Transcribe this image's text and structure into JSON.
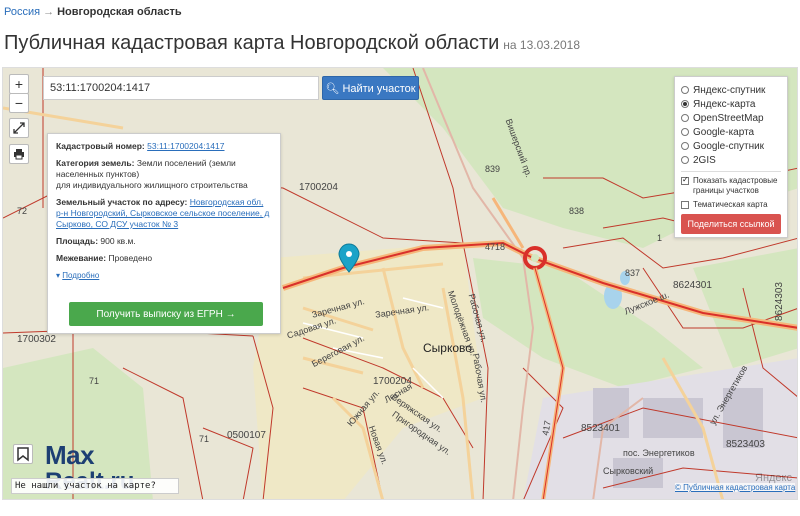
{
  "breadcrumb": {
    "root": "Россия",
    "separator": "→",
    "current": "Новгородская область"
  },
  "page": {
    "title": "Публичная кадастровая карта Новгородской области",
    "date": "на 13.03.2018"
  },
  "map": {
    "zoom_in": "+",
    "zoom_out": "−",
    "search_value": "53:11:1700204:1417",
    "search_button": "Найти участок",
    "labels": {
      "block_1700204_top": "1700204",
      "block_1700204_bottom": "1700204",
      "block_1700302": "1700302",
      "block_0500107": "0500107",
      "block_8624301": "8624301",
      "block_8624303": "8624303",
      "block_8523401": "8523401",
      "block_8523403": "8523403",
      "village": "Сырково",
      "settlement": "пос. Энергетиков",
      "road_syrkovsky": "Сырковский",
      "street_zarechnaya_1": "Заречная ул.",
      "street_zarechnaya_2": "Заречная ул.",
      "street_sadovaya": "Садовая ул.",
      "street_beregovaya": "Береговая ул.",
      "street_molodezhnaya": "Молодёжная ул.",
      "street_rabochaya_1": "Рабочая ул.",
      "street_rabochaya_2": "Рабочая ул.",
      "street_yuzhnaya": "Южная ул.",
      "street_lesnaya": "Лесная",
      "street_verzhskaya": "Веряжская ул.",
      "street_prigorodnaya": "Пригородная ул.",
      "street_novaya": "Новая ул.",
      "street_lyuzhskoe": "Лужское ш.",
      "street_energetikov": "ул. Энергетиков",
      "street_vishersky": "Вишерский пр.",
      "num_839": "839",
      "num_838": "838",
      "num_837": "837",
      "num_4718": "4718",
      "num_72": "72",
      "num_71a": "71",
      "num_71b": "71",
      "num_1": "1",
      "num_417": "417"
    }
  },
  "info_card": {
    "cadastral_label": "Кадастровый номер:",
    "cadastral_value": "53:11:1700204:1417",
    "category_label": "Категория земель:",
    "category_value": "Земли поселений (земли населенных пунктов)",
    "category_purpose": "для индивидуального жилищного строительства",
    "address_label": "Земельный участок по адресу:",
    "address_value": "Новгородская обл, р-н Новгородский, Сырковское сельское поселение, д Сырково, СО ДСУ участок № 3",
    "area_label": "Площадь:",
    "area_value": "900 кв.м.",
    "survey_label": "Межевание:",
    "survey_value": "Проведено",
    "more_link": "Подробно",
    "egrn_button": "Получить выписку из ЕГРН →"
  },
  "layers": {
    "options": [
      {
        "label": "Яндекс-спутник",
        "selected": false
      },
      {
        "label": "Яндекс-карта",
        "selected": true
      },
      {
        "label": "OpenStreetMap",
        "selected": false
      },
      {
        "label": "Google-карта",
        "selected": false
      },
      {
        "label": "Google-спутник",
        "selected": false
      },
      {
        "label": "2GIS",
        "selected": false
      }
    ],
    "show_borders_label": "Показать кадастровые границы участков",
    "show_borders_checked": true,
    "thematic_label": "Тематическая карта",
    "thematic_checked": false,
    "share_button": "Поделиться ссылкой"
  },
  "watermark": {
    "line1": "Max",
    "line2": "Realt.ru"
  },
  "question_text": "Не нашли участок на карте?",
  "footer_link": "© Публичная кадастровая карта",
  "yandex_mark": "Яндекс",
  "colors": {
    "link": "#2a6ebb",
    "search_button": "#3a78c2",
    "egrn_button": "#4aa84c",
    "share_button": "#d9534f",
    "boundary": "#c0392b",
    "highway": "#d9302a",
    "minor_road": "#f2c98a",
    "forest": "#cfe3b8",
    "industrial": "#e0dde4",
    "water": "#a8d3ec",
    "marker": "#1aa3c8"
  }
}
